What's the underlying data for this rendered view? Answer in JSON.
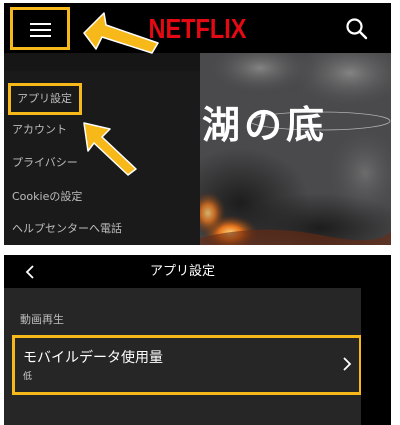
{
  "brand": {
    "logo_text": "NETFLIX"
  },
  "drawer": {
    "items": [
      {
        "label": "アプリ設定"
      },
      {
        "label": "アカウント"
      },
      {
        "label": "プライバシー"
      },
      {
        "label": "Cookieの設定"
      },
      {
        "label": "ヘルプセンターへ電話"
      }
    ]
  },
  "hero": {
    "title_text": "湖の底"
  },
  "settings_screen": {
    "title": "アプリ設定",
    "section_label": "動画再生",
    "item": {
      "title": "モバイルデータ使用量",
      "value": "低"
    }
  },
  "colors": {
    "netflix_red": "#e50914",
    "highlight": "#f7b81a",
    "background": "#000000",
    "drawer_bg": "#1a1a1a",
    "settings_bg": "#262626"
  },
  "icons": [
    "hamburger-menu-icon",
    "search-icon",
    "back-chevron-icon",
    "chevron-right-icon",
    "pointer-arrow-icon"
  ]
}
